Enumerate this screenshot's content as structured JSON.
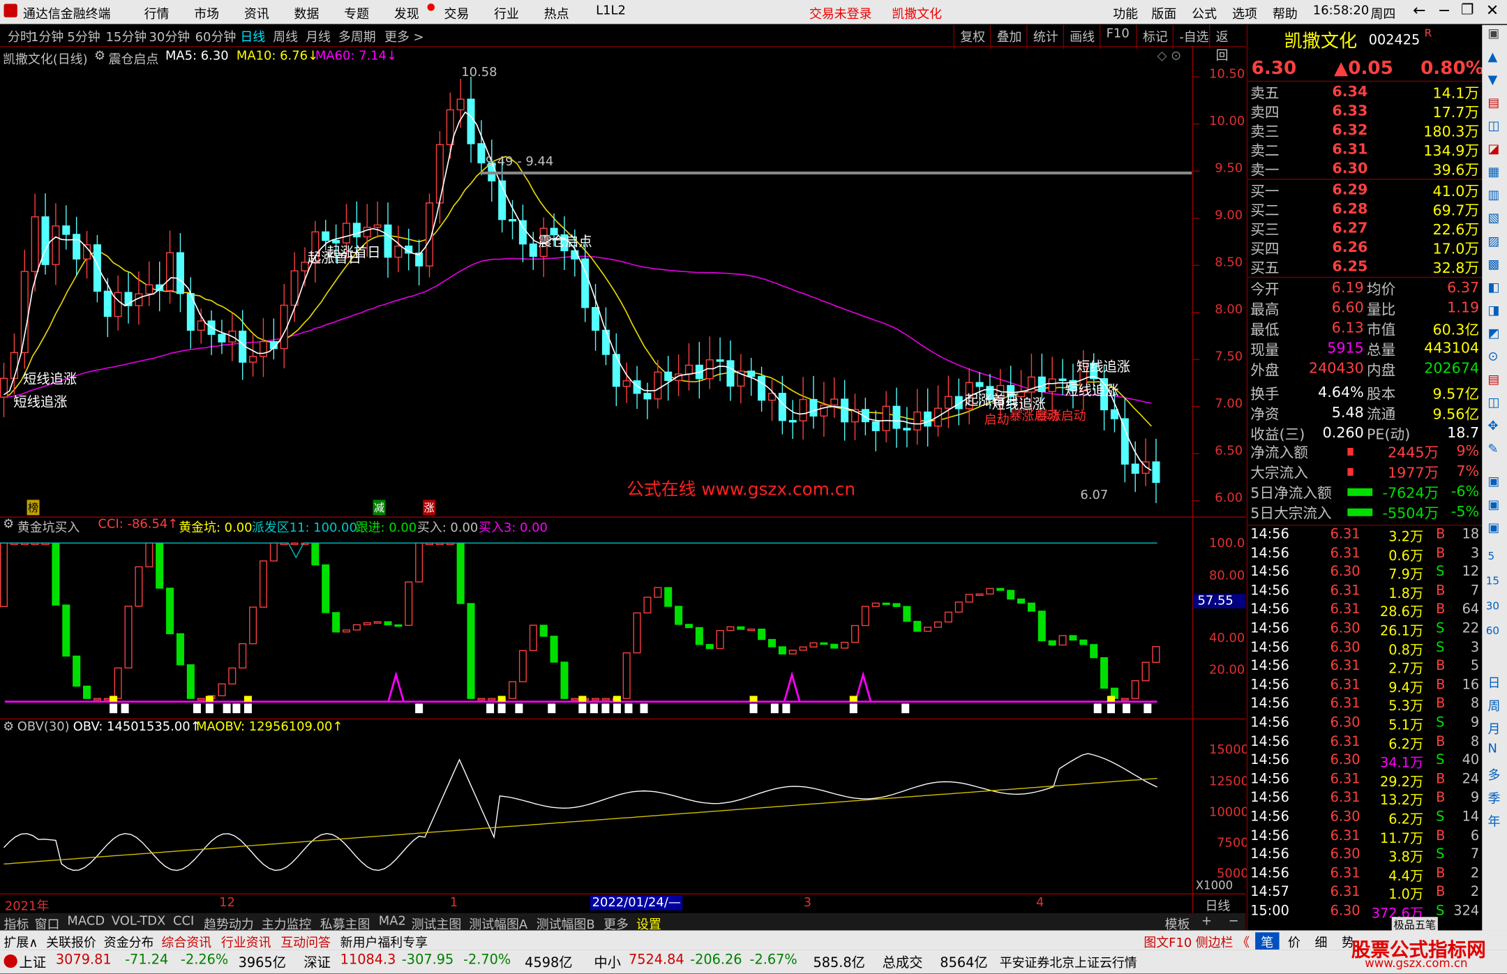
{
  "titlebar": {
    "app": "通达信金融终端",
    "menus": [
      "行情",
      "市场",
      "资讯",
      "数据",
      "专题",
      "发现",
      "交易",
      "行业",
      "热点",
      "L1L2"
    ],
    "status": "交易未登录",
    "stock": "凯撒文化",
    "right_menus": [
      "功能",
      "版面",
      "公式",
      "选项",
      "帮助"
    ],
    "time": "16:58:20",
    "weekday": "周四"
  },
  "periods": [
    "分时",
    "1分钟",
    "5分钟",
    "15分钟",
    "30分钟",
    "60分钟",
    "日线",
    "周线",
    "月线",
    "多周期",
    "更多 >"
  ],
  "toolbar": [
    "复权",
    "叠加",
    "统计",
    "画线",
    "F10",
    "标记",
    "-自选",
    "返回"
  ],
  "main_chart": {
    "stock_label": "凯撒文化(日线)",
    "formula": "震仓启点",
    "ma5": "MA5: 6.30",
    "ma10": "MA10: 6.76↓",
    "ma60": "MA60: 7.14↓",
    "high_label": "10.58",
    "range_label": "9.49 - 9.44",
    "low_label": "6.07",
    "watermark": "公式在线  www.gszx.com.cn",
    "y_ticks": [
      "10.50",
      "10.00",
      "9.50",
      "9.00",
      "8.50",
      "8.00",
      "7.50",
      "7.00",
      "6.50",
      "6.00"
    ],
    "signals": [
      "短线追涨",
      "短线追涨",
      "起涨首日",
      "起涨首日",
      "震仓启点",
      "短线追涨",
      "起涨首日",
      "短线追涨",
      "短线追涨",
      "启动",
      "暴涨启动",
      "暴涨启动"
    ],
    "markers": [
      "榜",
      "减",
      "涨"
    ]
  },
  "mid_chart": {
    "name": "黄金坑买入",
    "cci": "CCI: -86.54↑",
    "gold": "黄金坑: 0.00",
    "paifa": "派发区11: 100.00",
    "genjin": "跟进: 0.00",
    "mairu": "买入: 0.00",
    "mairu3": "买入3: 0.00",
    "y_ticks": [
      "100.0",
      "80.00",
      "40.00",
      "20.00"
    ],
    "current": "57.55"
  },
  "obv_chart": {
    "name": "OBV(30)",
    "obv": "OBV: 14501535.00↑",
    "maobv": "MAOBV: 12956109.00↑",
    "y_ticks": [
      "15000",
      "12500",
      "10000",
      "7500",
      "5000"
    ],
    "unit": "X1000"
  },
  "x_axis": {
    "labels": [
      "2021年",
      "12",
      "1",
      "3",
      "4"
    ],
    "date": "2022/01/24/—",
    "period": "日线"
  },
  "bottom_tabs": [
    "指标",
    "窗口",
    "MACD",
    "VOL-TDX",
    "CCI",
    "趋势动力",
    "主力监控",
    "私募主图",
    "MA2",
    "测试主图",
    "测试幅图A",
    "测试幅图B",
    "更多",
    "设置"
  ],
  "bottom_right": "模板",
  "info_tabs": [
    "扩展∧",
    "关联报价",
    "资金分布",
    "综合资讯",
    "行业资讯",
    "互动问答",
    "新用户福利专享"
  ],
  "info_right": [
    "图文F10",
    "侧边栏 《",
    "笔",
    "价",
    "细",
    "势"
  ],
  "statusbar": {
    "sh_label": "上证",
    "sh": "3079.81",
    "sh_chg": "-71.24",
    "sh_pct": "-2.26%",
    "sh_amt": "3965亿",
    "sz_label": "深证",
    "sz": "11084.3",
    "sz_chg": "-307.95",
    "sz_pct": "-2.70%",
    "sz_amt": "4598亿",
    "zx_label": "中小",
    "zx": "7524.84",
    "zx_chg": "-206.26",
    "zx_pct": "-2.67%",
    "zx_amt": "585.8亿",
    "total_label": "总成交",
    "total": "8564亿",
    "broker": "平安证券北京上证云行情",
    "logo": "股票公式指标网",
    "logo_url": "www.gszx.com.cn"
  },
  "quote": {
    "name": "凯撒文化",
    "code": "002425",
    "flag": "R",
    "price": "6.30",
    "change": "▲0.05",
    "pct": "0.80%",
    "asks": [
      {
        "label": "卖五",
        "price": "6.34",
        "vol": "14.1万"
      },
      {
        "label": "卖四",
        "price": "6.33",
        "vol": "17.7万"
      },
      {
        "label": "卖三",
        "price": "6.32",
        "vol": "180.3万"
      },
      {
        "label": "卖二",
        "price": "6.31",
        "vol": "134.9万"
      },
      {
        "label": "卖一",
        "price": "6.30",
        "vol": "39.6万"
      }
    ],
    "bids": [
      {
        "label": "买一",
        "price": "6.29",
        "vol": "41.0万"
      },
      {
        "label": "买二",
        "price": "6.28",
        "vol": "69.7万"
      },
      {
        "label": "买三",
        "price": "6.27",
        "vol": "22.6万"
      },
      {
        "label": "买四",
        "price": "6.26",
        "vol": "17.0万"
      },
      {
        "label": "买五",
        "price": "6.25",
        "vol": "32.8万"
      }
    ],
    "stats": [
      [
        "今开",
        "6.19",
        "均价",
        "6.37"
      ],
      [
        "最高",
        "6.60",
        "量比",
        "1.19"
      ],
      [
        "最低",
        "6.13",
        "市值",
        "60.3亿"
      ],
      [
        "现量",
        "5915",
        "总量",
        "443104"
      ],
      [
        "外盘",
        "240430",
        "内盘",
        "202674"
      ],
      [
        "换手",
        "4.64%",
        "股本",
        "9.57亿"
      ],
      [
        "净资",
        "5.48",
        "流通",
        "9.56亿"
      ],
      [
        "收益(三)",
        "0.260",
        "PE(动)",
        "18.7"
      ]
    ],
    "flows": [
      [
        "净流入额",
        "2445万",
        "9%"
      ],
      [
        "大宗流入",
        "1977万",
        "7%"
      ],
      [
        "5日净流入额",
        "-7624万",
        "-6%"
      ],
      [
        "5日大宗流入",
        "-5504万",
        "-5%"
      ]
    ],
    "ticks": [
      [
        "14:56",
        "6.31",
        "3.2万",
        "B",
        "18"
      ],
      [
        "14:56",
        "6.31",
        "0.6万",
        "B",
        "3"
      ],
      [
        "14:56",
        "6.30",
        "7.9万",
        "S",
        "12"
      ],
      [
        "14:56",
        "6.31",
        "1.8万",
        "B",
        "7"
      ],
      [
        "14:56",
        "6.31",
        "28.6万",
        "B",
        "64"
      ],
      [
        "14:56",
        "6.30",
        "26.1万",
        "S",
        "22"
      ],
      [
        "14:56",
        "6.30",
        "0.8万",
        "S",
        "3"
      ],
      [
        "14:56",
        "6.31",
        "2.7万",
        "B",
        "5"
      ],
      [
        "14:56",
        "6.31",
        "9.4万",
        "B",
        "16"
      ],
      [
        "14:56",
        "6.31",
        "5.3万",
        "B",
        "8"
      ],
      [
        "14:56",
        "6.30",
        "5.1万",
        "S",
        "9"
      ],
      [
        "14:56",
        "6.31",
        "6.2万",
        "B",
        "8"
      ],
      [
        "14:56",
        "6.30",
        "34.1万",
        "S",
        "40"
      ],
      [
        "14:56",
        "6.31",
        "29.2万",
        "B",
        "24"
      ],
      [
        "14:56",
        "6.31",
        "13.2万",
        "B",
        "9"
      ],
      [
        "14:56",
        "6.30",
        "6.2万",
        "S",
        "14"
      ],
      [
        "14:56",
        "6.31",
        "11.7万",
        "B",
        "6"
      ],
      [
        "14:56",
        "6.30",
        "3.8万",
        "S",
        "7"
      ],
      [
        "14:56",
        "6.31",
        "4.4万",
        "B",
        "2"
      ],
      [
        "14:57",
        "6.31",
        "1.0万",
        "B",
        "2"
      ],
      [
        "15:00",
        "6.30",
        "372.6万",
        "S",
        "324"
      ]
    ],
    "side_label": "极品五笔"
  },
  "iconbar": [
    "日",
    "周",
    "月",
    "N",
    "多",
    "季",
    "年"
  ]
}
